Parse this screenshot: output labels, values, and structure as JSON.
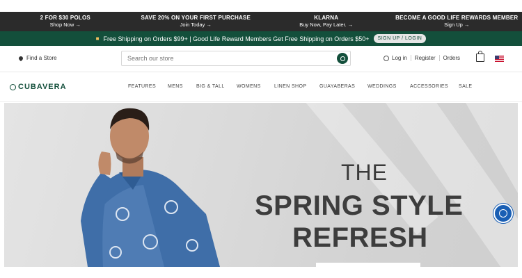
{
  "promos": [
    {
      "title": "2 FOR $30 POLOS",
      "sub": "Shop Now →"
    },
    {
      "title": "SAVE 20% ON YOUR FIRST PURCHASE",
      "sub": "Join Today →"
    },
    {
      "title": "KLARNA",
      "sub": "Buy Now, Pay Later. →"
    },
    {
      "title": "BECOME A GOOD LIFE REWARDS MEMBER",
      "sub": "Sign Up →"
    }
  ],
  "shipping": {
    "text": "Free Shipping on Orders $99+ | Good Life Reward Members Get Free Shipping on Orders $50+",
    "button": "SIGN UP / LOGIN"
  },
  "util": {
    "find_store": "Find a Store",
    "search_placeholder": "Search our store",
    "login": "Log in",
    "register": "Register",
    "orders": "Orders"
  },
  "logo": "CUBAVERA",
  "nav": [
    "FEATURES",
    "MENS",
    "BIG & TALL",
    "WOMENS",
    "LINEN SHOP",
    "GUAYABERAS",
    "WEDDINGS",
    "ACCESSORIES",
    "SALE"
  ],
  "hero": {
    "line1": "THE",
    "line2": "SPRING STYLE",
    "line3": "REFRESH"
  },
  "colors": {
    "brand_green": "#134f3b",
    "promo_bg": "#2b2b2b",
    "accessibility_blue": "#1a5fb4"
  }
}
